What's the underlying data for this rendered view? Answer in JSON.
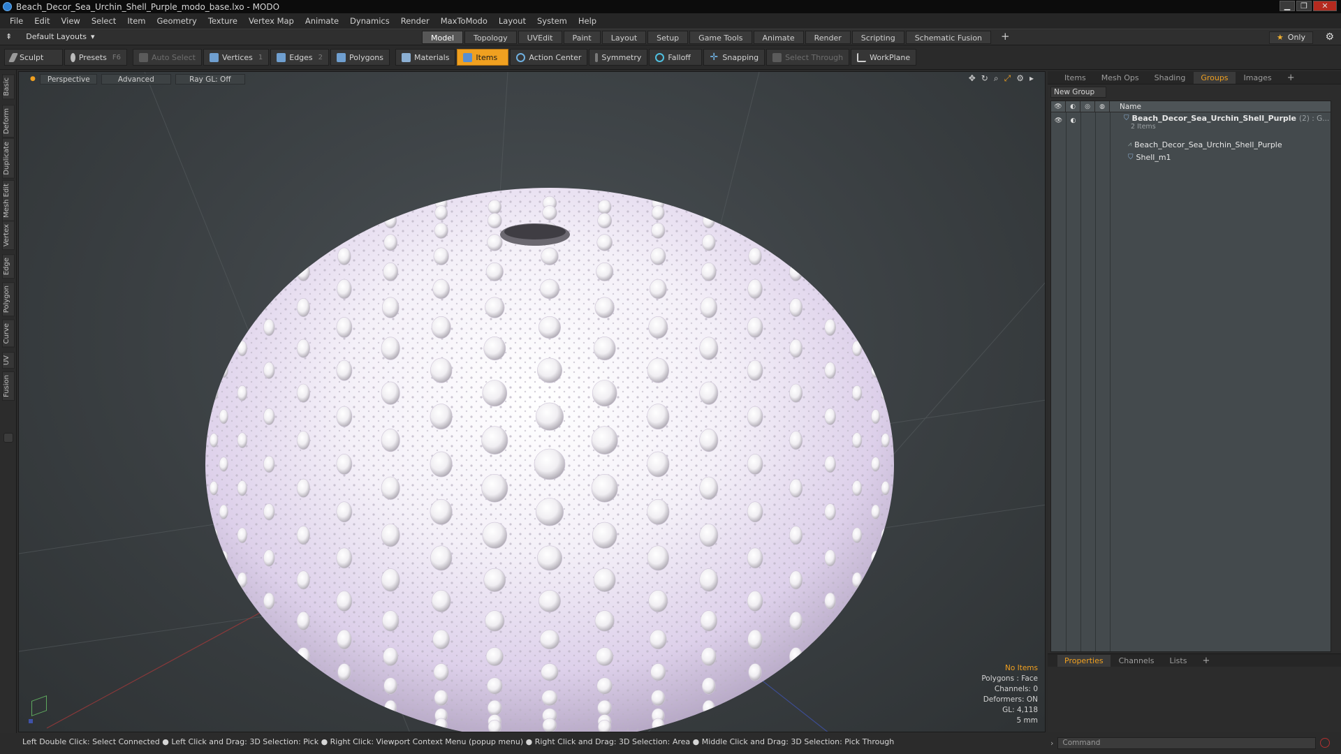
{
  "window": {
    "title": "Beach_Decor_Sea_Urchin_Shell_Purple_modo_base.lxo - MODO"
  },
  "menu": [
    "File",
    "Edit",
    "View",
    "Select",
    "Item",
    "Geometry",
    "Texture",
    "Vertex Map",
    "Animate",
    "Dynamics",
    "Render",
    "MaxToModo",
    "Layout",
    "System",
    "Help"
  ],
  "layout": {
    "default_layouts": "Default Layouts",
    "tabs": [
      "Model",
      "Topology",
      "UVEdit",
      "Paint",
      "Layout",
      "Setup",
      "Game Tools",
      "Animate",
      "Render",
      "Scripting",
      "Schematic Fusion"
    ],
    "active_tab": "Model",
    "only_label": "Only"
  },
  "toolbar": {
    "sculpt": "Sculpt",
    "presets": "Presets",
    "presets_key": "F6",
    "auto_select": "Auto Select",
    "vertices": "Vertices",
    "vertices_count": "1",
    "edges": "Edges",
    "edges_count": "2",
    "polygons": "Polygons",
    "materials": "Materials",
    "items": "Items",
    "action_center": "Action Center",
    "symmetry": "Symmetry",
    "falloff": "Falloff",
    "snapping": "Snapping",
    "select_through": "Select Through",
    "workplane": "WorkPlane"
  },
  "left_tabs": [
    "Basic",
    "Deform",
    "Duplicate",
    "Mesh Edit",
    "Vertex",
    "Edge",
    "Polygon",
    "Curve",
    "UV",
    "Fusion"
  ],
  "viewport": {
    "view_mode": "Perspective",
    "shading": "Advanced",
    "raygl": "Ray GL: Off",
    "info": {
      "no_items": "No Items",
      "polygons": "Polygons : Face",
      "channels": "Channels: 0",
      "deformers": "Deformers: ON",
      "gl": "GL: 4,118",
      "scale": "5 mm"
    }
  },
  "right_panel": {
    "tabs": [
      "Items",
      "Mesh Ops",
      "Shading",
      "Groups",
      "Images"
    ],
    "active_tab": "Groups",
    "new_group": "New Group",
    "name_header": "Name",
    "group_name": "Beach_Decor_Sea_Urchin_Shell_Purple",
    "group_suffix": "(2) : G...",
    "group_count": "2 Items",
    "child1": "Beach_Decor_Sea_Urchin_Shell_Purple",
    "child2": "Shell_m1"
  },
  "properties_panel": {
    "tabs": [
      "Properties",
      "Channels",
      "Lists"
    ],
    "active_tab": "Properties"
  },
  "statusbar": {
    "hint": "Left Double Click: Select Connected ● Left Click and Drag: 3D Selection: Pick ● Right Click: Viewport Context Menu (popup menu) ● Right Click and Drag: 3D Selection: Area ● Middle Click and Drag: 3D Selection: Pick Through"
  },
  "command": {
    "placeholder": "Command"
  },
  "colors": {
    "accent": "#f0a020",
    "shell_base": "#f4f2f6",
    "shell_purple": "#d9c8ec"
  }
}
